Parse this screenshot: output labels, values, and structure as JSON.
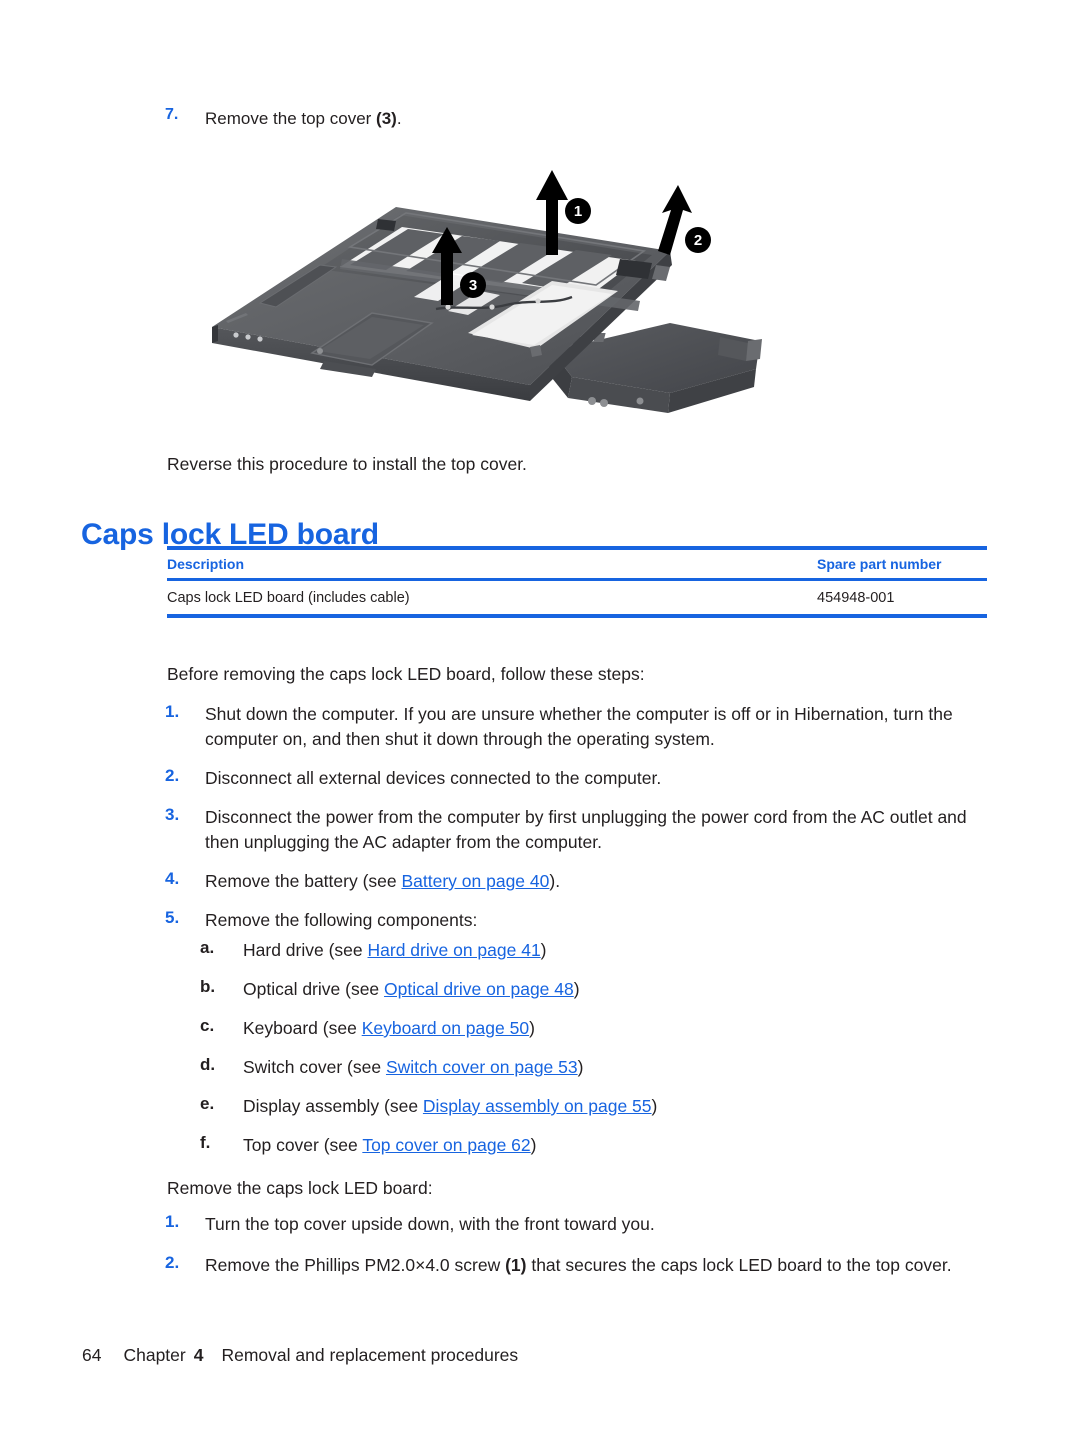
{
  "step_seven": {
    "number": "7.",
    "text_before": "Remove the top cover ",
    "callout_ref": "(3)",
    "text_after": "."
  },
  "figure": {
    "name": "laptop-top-cover-removal-photo",
    "alt": "Laptop base enclosure with top cover being lifted, three numbered callout arrows",
    "callouts": [
      {
        "id": "1",
        "label": "1"
      },
      {
        "id": "2",
        "label": "2"
      },
      {
        "id": "3",
        "label": "3"
      }
    ]
  },
  "reverse_note": "Reverse this procedure to install the top cover.",
  "section_heading": "Caps lock LED board",
  "parts_table": {
    "headers": [
      "Description",
      "Spare part number"
    ],
    "rows": [
      {
        "description": "Caps lock LED board (includes cable)",
        "spare_part_number": "454948-001"
      }
    ]
  },
  "before_intro": "Before removing the caps lock LED board, follow these steps:",
  "pre_steps": [
    {
      "number": "1.",
      "text": "Shut down the computer. If you are unsure whether the computer is off or in Hibernation, turn the computer on, and then shut it down through the operating system."
    },
    {
      "number": "2.",
      "text": "Disconnect all external devices connected to the computer."
    },
    {
      "number": "3.",
      "text": "Disconnect the power from the computer by first unplugging the power cord from the AC outlet and then unplugging the AC adapter from the computer."
    },
    {
      "number": "4.",
      "text_before": "Remove the battery (see ",
      "link": "Battery on page 40",
      "text_after": ")."
    },
    {
      "number": "5.",
      "text": "Remove the following components:"
    }
  ],
  "sub_steps": [
    {
      "letter": "a.",
      "text_before": "Hard drive (see ",
      "link": "Hard drive on page 41",
      "text_after": ")"
    },
    {
      "letter": "b.",
      "text_before": "Optical drive (see ",
      "link": "Optical drive on page 48",
      "text_after": ")"
    },
    {
      "letter": "c.",
      "text_before": "Keyboard (see ",
      "link": "Keyboard on page 50",
      "text_after": ")"
    },
    {
      "letter": "d.",
      "text_before": "Switch cover (see ",
      "link": "Switch cover on page 53",
      "text_after": ")"
    },
    {
      "letter": "e.",
      "text_before": "Display assembly (see ",
      "link": "Display assembly on page 55",
      "text_after": ")"
    },
    {
      "letter": "f.",
      "text_before": "Top cover (see ",
      "link": "Top cover on page 62",
      "text_after": ")"
    }
  ],
  "remove_intro": "Remove the caps lock LED board:",
  "remove_steps": [
    {
      "number": "1.",
      "text": "Turn the top cover upside down, with the front toward you."
    },
    {
      "number": "2.",
      "text_before": "Remove the Phillips PM2.0×4.0 screw ",
      "callout_ref": "(1)",
      "text_after": " that secures the caps lock LED board to the top cover."
    }
  ],
  "footer": {
    "page_number": "64",
    "chapter_word": "Chapter",
    "chapter_number": "4",
    "chapter_title": "Removal and replacement procedures"
  },
  "colors": {
    "accent_blue": "#1764e0",
    "body_text": "#231f20",
    "callout_fill": "#000000"
  }
}
